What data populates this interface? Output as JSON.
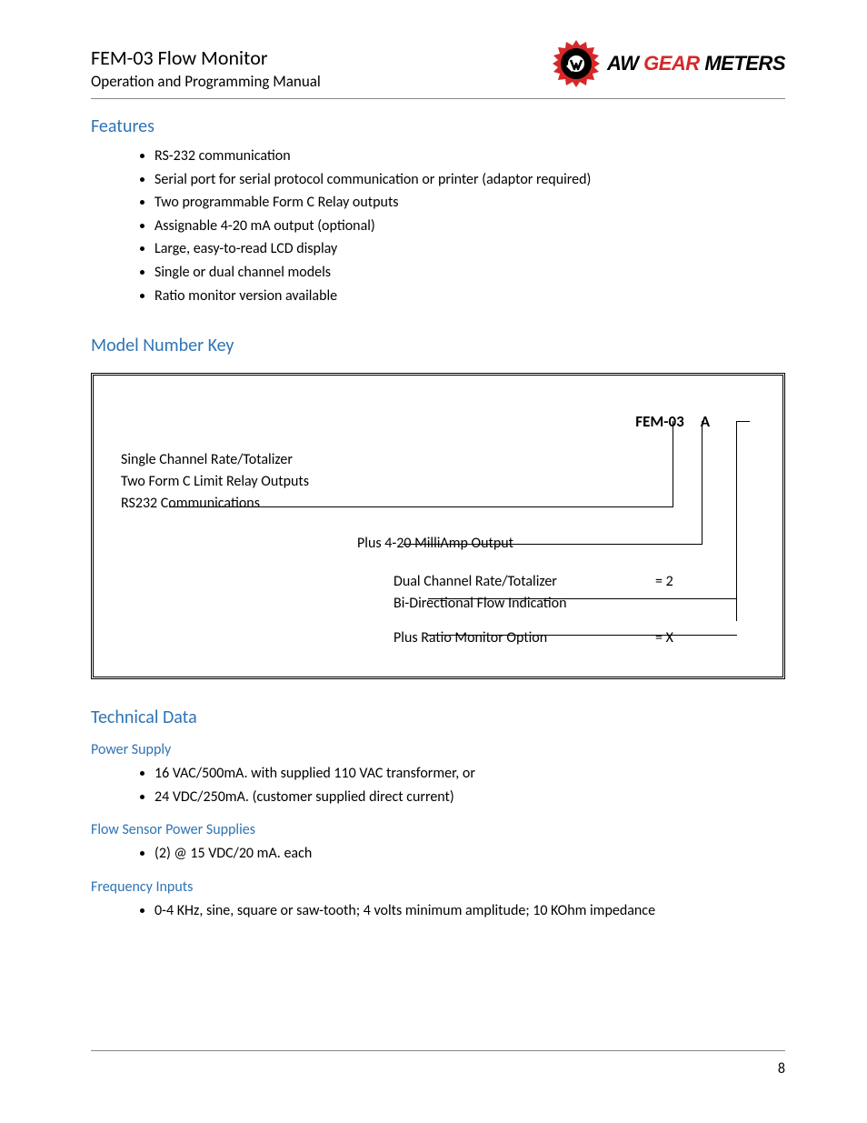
{
  "header": {
    "title": "FEM-03 Flow Monitor",
    "subtitle": "Operation and Programming Manual",
    "brand_aw": "AW",
    "brand_gear": "GEAR",
    "brand_meters": "METERS"
  },
  "sections": {
    "features_heading": "Features",
    "features": [
      "RS-232 communication",
      "Serial port for serial protocol communication or printer (adaptor required)",
      "Two programmable Form C Relay outputs",
      "Assignable 4-20 mA output (optional)",
      "Large, easy-to-read LCD display",
      "Single or dual channel models",
      "Ratio monitor version available"
    ],
    "model_key_heading": "Model Number Key",
    "model_key": {
      "header_part1": "FEM-03",
      "header_part2": "A",
      "base_lines": [
        "Single Channel Rate/Totalizer",
        "Two Form C Limit Relay Outputs",
        "RS232 Communications"
      ],
      "opt1": "Plus 4-20 MilliAmp Output",
      "opt2_lines": [
        "Dual Channel Rate/Totalizer",
        "Bi-Directional Flow Indication"
      ],
      "opt2_code": "= 2",
      "opt3": "Plus Ratio Monitor Option",
      "opt3_code": "= X"
    },
    "tech_heading": "Technical Data",
    "power_supply_heading": "Power Supply",
    "power_supply": [
      "16 VAC/500mA. with supplied 110 VAC transformer,  or",
      "24 VDC/250mA. (customer supplied direct current)"
    ],
    "flow_sensor_heading": "Flow Sensor Power Supplies",
    "flow_sensor": [
      "(2) @ 15 VDC/20 mA. each"
    ],
    "freq_inputs_heading": "Frequency Inputs",
    "freq_inputs": [
      "0-4 KHz, sine, square or saw-tooth;  4 volts minimum amplitude; 10 KOhm impedance"
    ]
  },
  "page_number": "8"
}
